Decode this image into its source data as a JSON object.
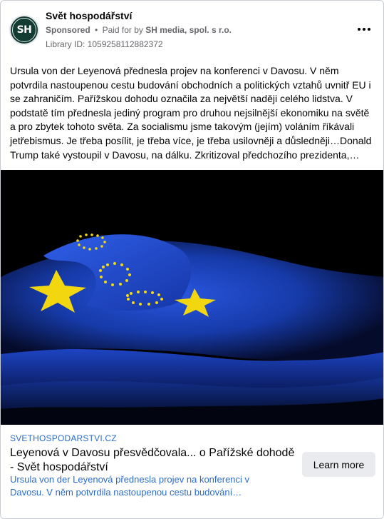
{
  "advertiser": {
    "page_name": "Svět hospodářství",
    "avatar_initials": "SH",
    "sponsored_label": "Sponsored",
    "separator": "•",
    "paid_for_prefix": "Paid for by",
    "paid_for_by": "SH media, spol. s r.o.",
    "library_id": "Library ID: 1059258112882372",
    "more_icon": "more-horizontal-icon"
  },
  "post": {
    "body": "Ursula von der Leyenová přednesla projev na konferenci v Davosu. V něm potvrdila nastoupenou cestu budování obchodních a politických vztahů uvnitř EU i se zahraničím. Pařížskou dohodu označila za největší naději celého lidstva. V podstatě tím přednesla jediný program pro druhou nejsilnější ekonomiku na světě a pro zbytek tohoto světa. Za socialismu jsme takovým (jejím) voláním říkávali jetřebismus. Je třeba posílit, je třeba více, je třeba usilovněji a důsledněji…Donald Trump také vystoupil v Davosu, na dálku. Zkritizoval předchozího prezidenta,…"
  },
  "image": {
    "subject": "folded-eu-flags-photo"
  },
  "link_preview": {
    "domain": "SVETHOSPODARSTVI.CZ",
    "title": "Leyenová v Davosu přesvědčovala... o Pařížské dohodě - Svět hospodářství",
    "description": "Ursula von der Leyenová přednesla projev na konferenci v Davosu. V něm potvrdila nastoupenou cestu budování…",
    "cta_label": "Learn more"
  },
  "colors": {
    "avatar_bg": "#123b33",
    "link_blue": "#2b6ccb",
    "cta_bg": "#e9ebee",
    "flag_blue": "#1a3fb0",
    "star_yellow": "#f5d90a"
  }
}
